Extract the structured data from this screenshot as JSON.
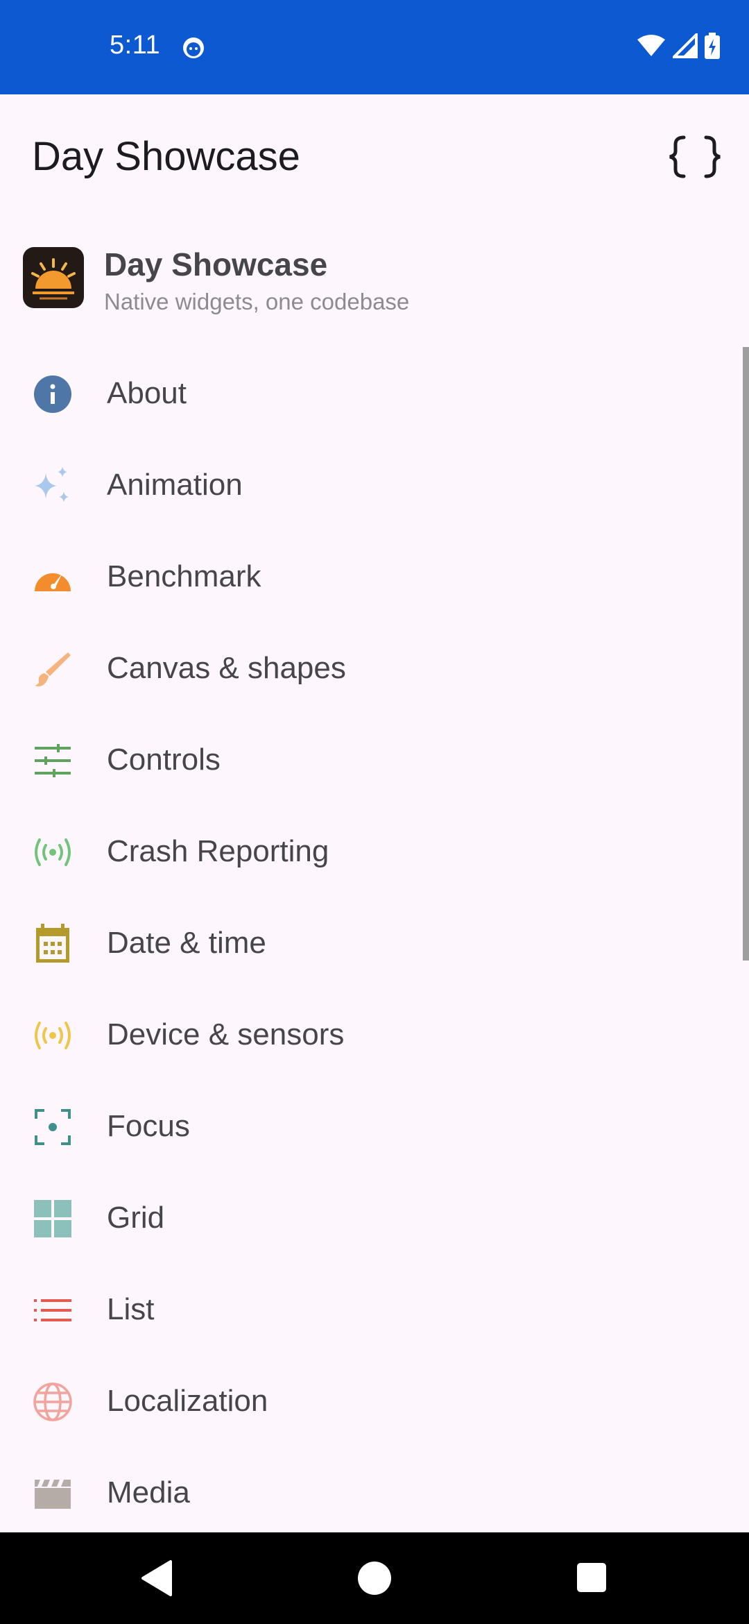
{
  "status_bar": {
    "time": "5:11",
    "left_icon": "notification-face-icon",
    "right_icons": [
      "wifi-icon",
      "cell-signal-icon",
      "battery-charging-icon"
    ],
    "background": "#0c59d1"
  },
  "app_bar": {
    "title": "Day Showcase",
    "action_icon": "code-braces-icon"
  },
  "drawer_header": {
    "title": "Day Showcase",
    "subtitle": "Native widgets, one codebase",
    "icon": "sunrise-app-icon"
  },
  "menu": {
    "items": [
      {
        "label": "About",
        "icon": "info-icon",
        "color": "#4e76a6"
      },
      {
        "label": "Animation",
        "icon": "sparkles-icon",
        "color": "#a9c8ec"
      },
      {
        "label": "Benchmark",
        "icon": "speedometer-icon",
        "color": "#f28c2c"
      },
      {
        "label": "Canvas & shapes",
        "icon": "brush-icon",
        "color": "#f5b37e"
      },
      {
        "label": "Controls",
        "icon": "sliders-icon",
        "color": "#5fa35f"
      },
      {
        "label": "Crash Reporting",
        "icon": "broadcast-icon",
        "color": "#72c47a"
      },
      {
        "label": "Date & time",
        "icon": "calendar-icon",
        "color": "#b39a2a"
      },
      {
        "label": "Device & sensors",
        "icon": "sensor-broadcast-icon",
        "color": "#f0c64a"
      },
      {
        "label": "Focus",
        "icon": "focus-icon",
        "color": "#3f8f8f"
      },
      {
        "label": "Grid",
        "icon": "grid-icon",
        "color": "#8cc0bb"
      },
      {
        "label": "List",
        "icon": "list-icon",
        "color": "#e45a4f"
      },
      {
        "label": "Localization",
        "icon": "globe-icon",
        "color": "#f2a39c"
      },
      {
        "label": "Media",
        "icon": "clapperboard-icon",
        "color": "#b5aca8"
      }
    ]
  },
  "nav_bar": {
    "buttons": [
      "back-icon",
      "home-icon",
      "recents-icon"
    ]
  }
}
